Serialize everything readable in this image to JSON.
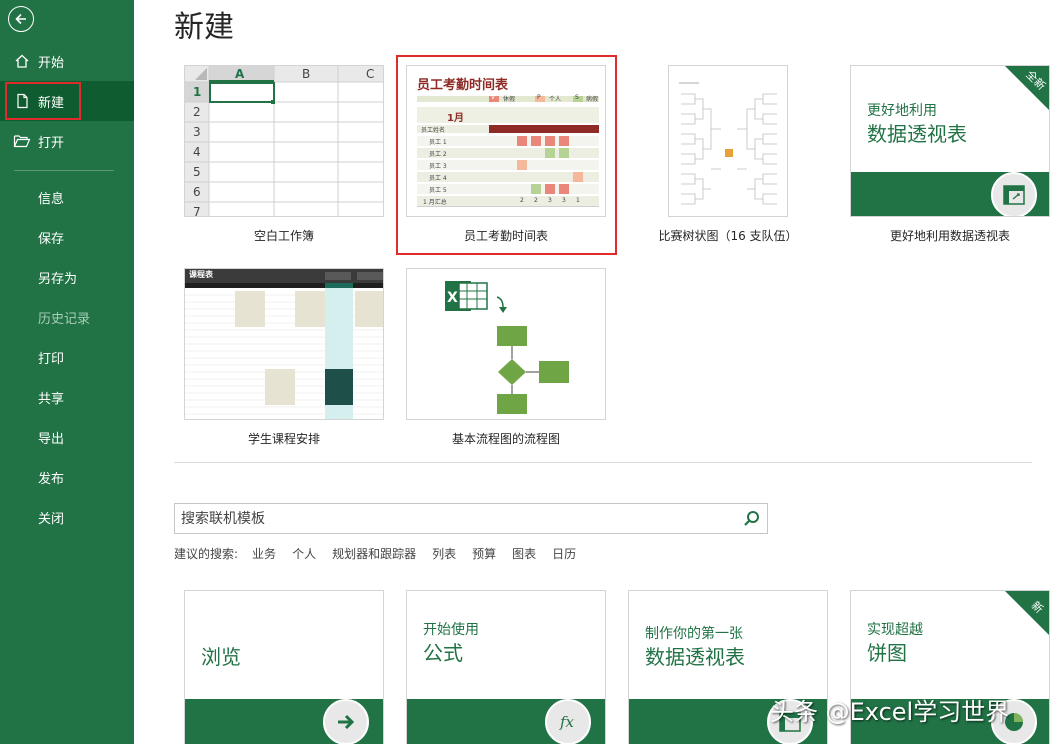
{
  "sidebar": {
    "items": [
      {
        "label": "开始",
        "icon": "home-icon"
      },
      {
        "label": "新建",
        "icon": "new-file-icon"
      },
      {
        "label": "打开",
        "icon": "open-folder-icon"
      },
      {
        "label": "信息"
      },
      {
        "label": "保存"
      },
      {
        "label": "另存为"
      },
      {
        "label": "历史记录"
      },
      {
        "label": "打印"
      },
      {
        "label": "共享"
      },
      {
        "label": "导出"
      },
      {
        "label": "发布"
      },
      {
        "label": "关闭"
      }
    ],
    "active_color": "#0e5c2f",
    "bg_color": "#217346"
  },
  "main": {
    "title": "新建",
    "templates": [
      {
        "label": "空白工作簿"
      },
      {
        "label": "员工考勤时间表"
      },
      {
        "label": "比赛树状图（16 支队伍）"
      },
      {
        "label": "更好地利用数据透视表"
      },
      {
        "label": "学生课程安排"
      },
      {
        "label": "基本流程图的流程图"
      }
    ],
    "blank": {
      "columns": [
        "A",
        "B",
        "C"
      ],
      "rows": [
        "1",
        "2",
        "3",
        "4",
        "5",
        "6",
        "7"
      ]
    },
    "attendance": {
      "title": "员工考勤时间表",
      "legend": [
        "V",
        "休假",
        "P",
        "个人",
        "S",
        "病假"
      ],
      "month": "1月",
      "employees": [
        "员工 1",
        "员工 2",
        "员工 3",
        "员工 4",
        "员工 5"
      ],
      "header_label": "员工姓名",
      "total_label": "1 月汇总",
      "totals": [
        "2",
        "2",
        "3",
        "3",
        "1"
      ]
    },
    "schedule": {
      "title": "课程表"
    },
    "pivot": {
      "small": "更好地利用",
      "big": "数据透视表",
      "badge": "全新"
    },
    "search": {
      "placeholder": "搜索联机模板"
    },
    "suggestions": {
      "label": "建议的搜索:",
      "items": [
        "业务",
        "个人",
        "规划器和跟踪器",
        "列表",
        "预算",
        "图表",
        "日历"
      ]
    },
    "tutorials": [
      {
        "small": "",
        "big": "浏览"
      },
      {
        "small": "开始使用",
        "big": "公式"
      },
      {
        "small": "制作你的第一张",
        "big": "数据透视表"
      },
      {
        "small": "实现超越",
        "big": "饼图",
        "badge": "新"
      }
    ]
  },
  "watermark": "头条 @Excel学习世界",
  "colors": {
    "accent": "#217346",
    "highlight": "#e02b2b"
  }
}
